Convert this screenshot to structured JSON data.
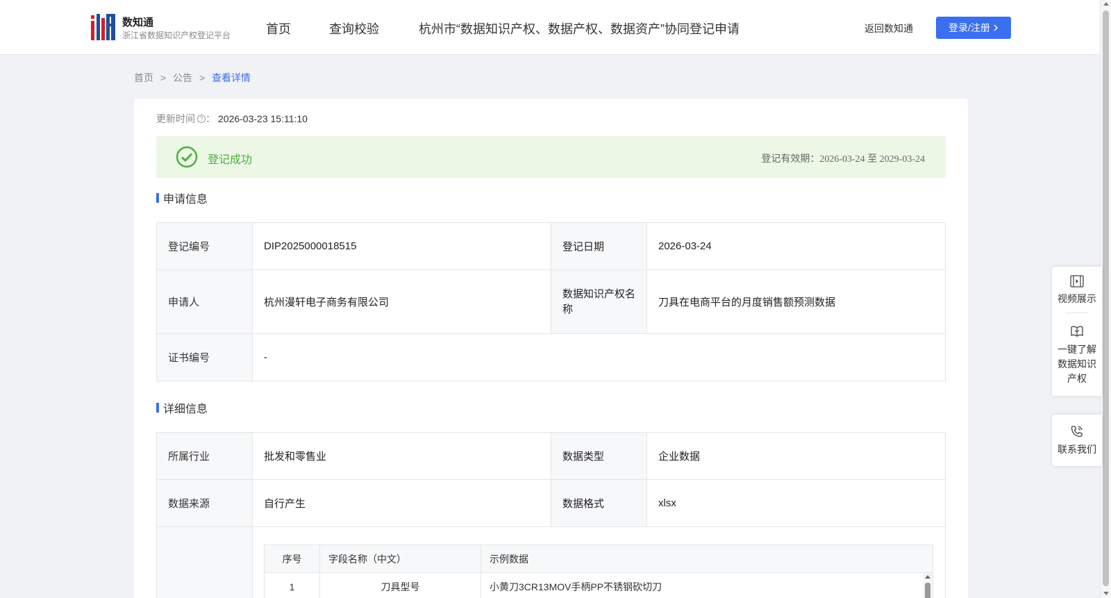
{
  "header": {
    "logo_title": "数知通",
    "logo_sub": "浙江省数据知识产权登记平台",
    "nav": [
      "首页",
      "查询校验",
      "杭州市“数据知识产权、数据产权、数据资产”协同登记申请"
    ],
    "back_link": "返回数知通",
    "login_label": "登录/注册"
  },
  "breadcrumb": {
    "items": [
      "首页",
      "公告",
      "查看详情"
    ],
    "separator": ">"
  },
  "detail": {
    "update_label": "更新时间",
    "update_colon": "：",
    "update_value": "2026-03-23 15:11:10",
    "status_text": "登记成功",
    "validity": "登记有效期：2026-03-24 至 2029-03-24",
    "colors": {
      "accent": "#3a6ff0",
      "success": "#4caf3e",
      "success_bg": "#ecf7e6"
    }
  },
  "apply_section": {
    "title": "申请信息",
    "reg_no_label": "登记编号",
    "reg_no": "DIP2025000018515",
    "reg_date_label": "登记日期",
    "reg_date": "2026-03-24",
    "applicant_label": "申请人",
    "applicant": "杭州漫轩电子商务有限公司",
    "name_label": "数据知识产权名称",
    "name": "刀具在电商平台的月度销售额预测数据",
    "cert_label": "证书编号",
    "cert": "-"
  },
  "detail_section": {
    "title": "详细信息",
    "industry_label": "所属行业",
    "industry": "批发和零售业",
    "type_label": "数据类型",
    "type": "企业数据",
    "source_label": "数据来源",
    "source": "自行产生",
    "format_label": "数据格式",
    "format": "xlsx"
  },
  "fields_table": {
    "headers": [
      "序号",
      "字段名称（中文）",
      "示例数据"
    ],
    "rows": [
      {
        "no": "1",
        "name": "刀具型号",
        "example": "小黄刀3CR13MOV手柄PP不锈钢砍切刀"
      }
    ]
  },
  "side_panel": {
    "video": "视频展示",
    "learn": "一键了解数据知识产权",
    "contact": "联系我们"
  }
}
